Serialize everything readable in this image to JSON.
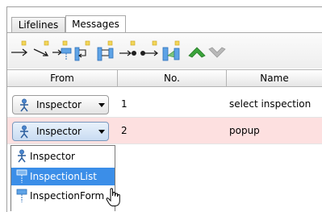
{
  "tabs": [
    {
      "label": "Lifelines",
      "active": false
    },
    {
      "label": "Messages",
      "active": true
    }
  ],
  "toolbar": {
    "buttons": [
      {
        "icon": "message-icon"
      },
      {
        "icon": "self-message-icon"
      },
      {
        "icon": "create-message-icon"
      },
      {
        "icon": "reentrant-message-icon"
      },
      {
        "icon": "return-message-icon"
      },
      {
        "icon": "lost-message-icon"
      },
      {
        "icon": "found-message-icon"
      },
      {
        "icon": "duration-message-icon"
      },
      {
        "icon": "move-up-icon"
      },
      {
        "icon": "move-down-icon"
      }
    ]
  },
  "table": {
    "columns": [
      "From",
      "No.",
      "Name"
    ],
    "rows": [
      {
        "from": "Inspector",
        "no": "1",
        "name": "select inspection",
        "highlighted": false
      },
      {
        "from": "Inspector",
        "no": "2",
        "name": "popup",
        "highlighted": true
      }
    ]
  },
  "dropdown": {
    "items": [
      {
        "label": "Inspector",
        "icon": "actor-icon",
        "selected": false
      },
      {
        "label": "InspectionList",
        "icon": "lifeline-icon",
        "selected": true
      },
      {
        "label": "InspectionForm",
        "icon": "lifeline-icon",
        "selected": false
      }
    ]
  },
  "colors": {
    "highlight_row": "#fde0e0",
    "selection": "#3b8ee8",
    "arrow_green": "#3aa33a"
  }
}
